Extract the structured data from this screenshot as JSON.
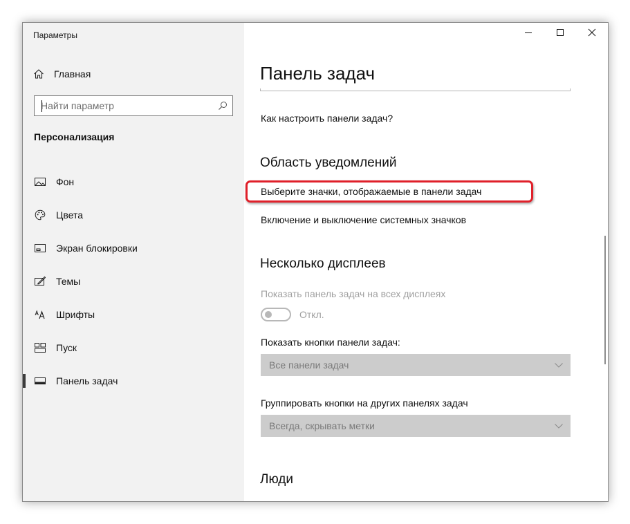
{
  "window": {
    "title": "Параметры",
    "controls": [
      "minimize-icon",
      "maximize-icon",
      "close-icon"
    ]
  },
  "sidebar": {
    "home_label": "Главная",
    "search": {
      "placeholder": "Найти параметр",
      "value": ""
    },
    "section_heading": "Персонализация",
    "items": [
      {
        "label": "Фон",
        "icon": "image-icon"
      },
      {
        "label": "Цвета",
        "icon": "palette-icon"
      },
      {
        "label": "Экран блокировки",
        "icon": "lock-screen-icon"
      },
      {
        "label": "Темы",
        "icon": "themes-icon"
      },
      {
        "label": "Шрифты",
        "icon": "fonts-icon"
      },
      {
        "label": "Пуск",
        "icon": "start-icon"
      },
      {
        "label": "Панель задач",
        "icon": "taskbar-icon",
        "active": true
      }
    ]
  },
  "main": {
    "title": "Панель задач",
    "help_link": "Как настроить панели задач?",
    "notification_area": {
      "heading": "Область уведомлений",
      "link_select_icons": "Выберите значки, отображаемые в панели задач",
      "link_system_icons": "Включение и выключение системных значков"
    },
    "multiple_displays": {
      "heading": "Несколько дисплеев",
      "show_taskbar_label": "Показать панель задач на всех дисплеях",
      "toggle_state": "Откл.",
      "show_buttons_label": "Показать кнопки панели задач:",
      "show_buttons_value": "Все панели задач",
      "combine_label": "Группировать кнопки на других панелях задач",
      "combine_value": "Всегда, скрывать метки"
    },
    "people": {
      "heading": "Люди"
    }
  },
  "colors": {
    "highlight": "#e0202a",
    "sidebar_bg": "#f2f2f2",
    "disabled": "#a0a0a0",
    "select_bg": "#cccccc"
  }
}
